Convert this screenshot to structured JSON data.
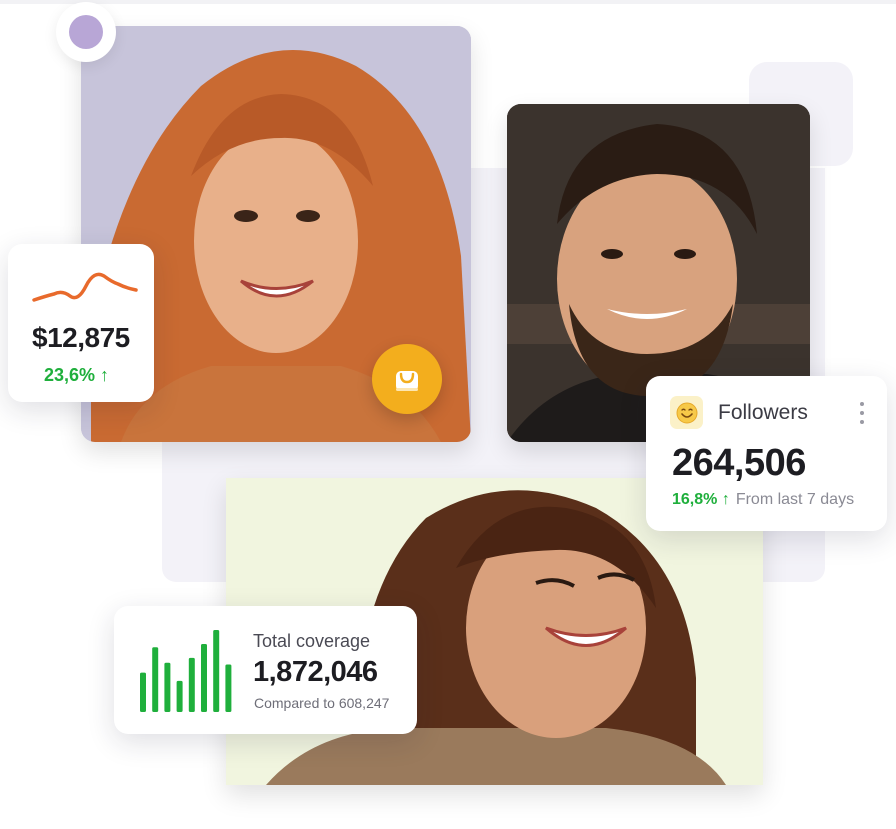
{
  "colors": {
    "accent_green": "#1faf3c",
    "accent_orange": "#e86a2c",
    "badge_yellow": "#f3ae1d",
    "dot_purple": "#b8a6d6",
    "panel_bg": "#f3f2f8"
  },
  "revenue_card": {
    "amount": "$12,875",
    "change": "23,6% ↑",
    "icon": "trend-line-icon"
  },
  "followers_card": {
    "title": "Followers",
    "count": "264,506",
    "change": "16,8% ↑",
    "period": "From last 7 days",
    "icon": "smiley-icon",
    "menu_icon": "more-vertical-icon"
  },
  "coverage_card": {
    "title": "Total coverage",
    "value": "1,872,046",
    "compare": "Compared to 608,247",
    "icon": "bar-chart-icon",
    "bar_levels": [
      0.48,
      0.79,
      0.6,
      0.38,
      0.66,
      0.83,
      1.0,
      0.58
    ]
  },
  "badge": {
    "icon": "shopping-bag-icon"
  }
}
